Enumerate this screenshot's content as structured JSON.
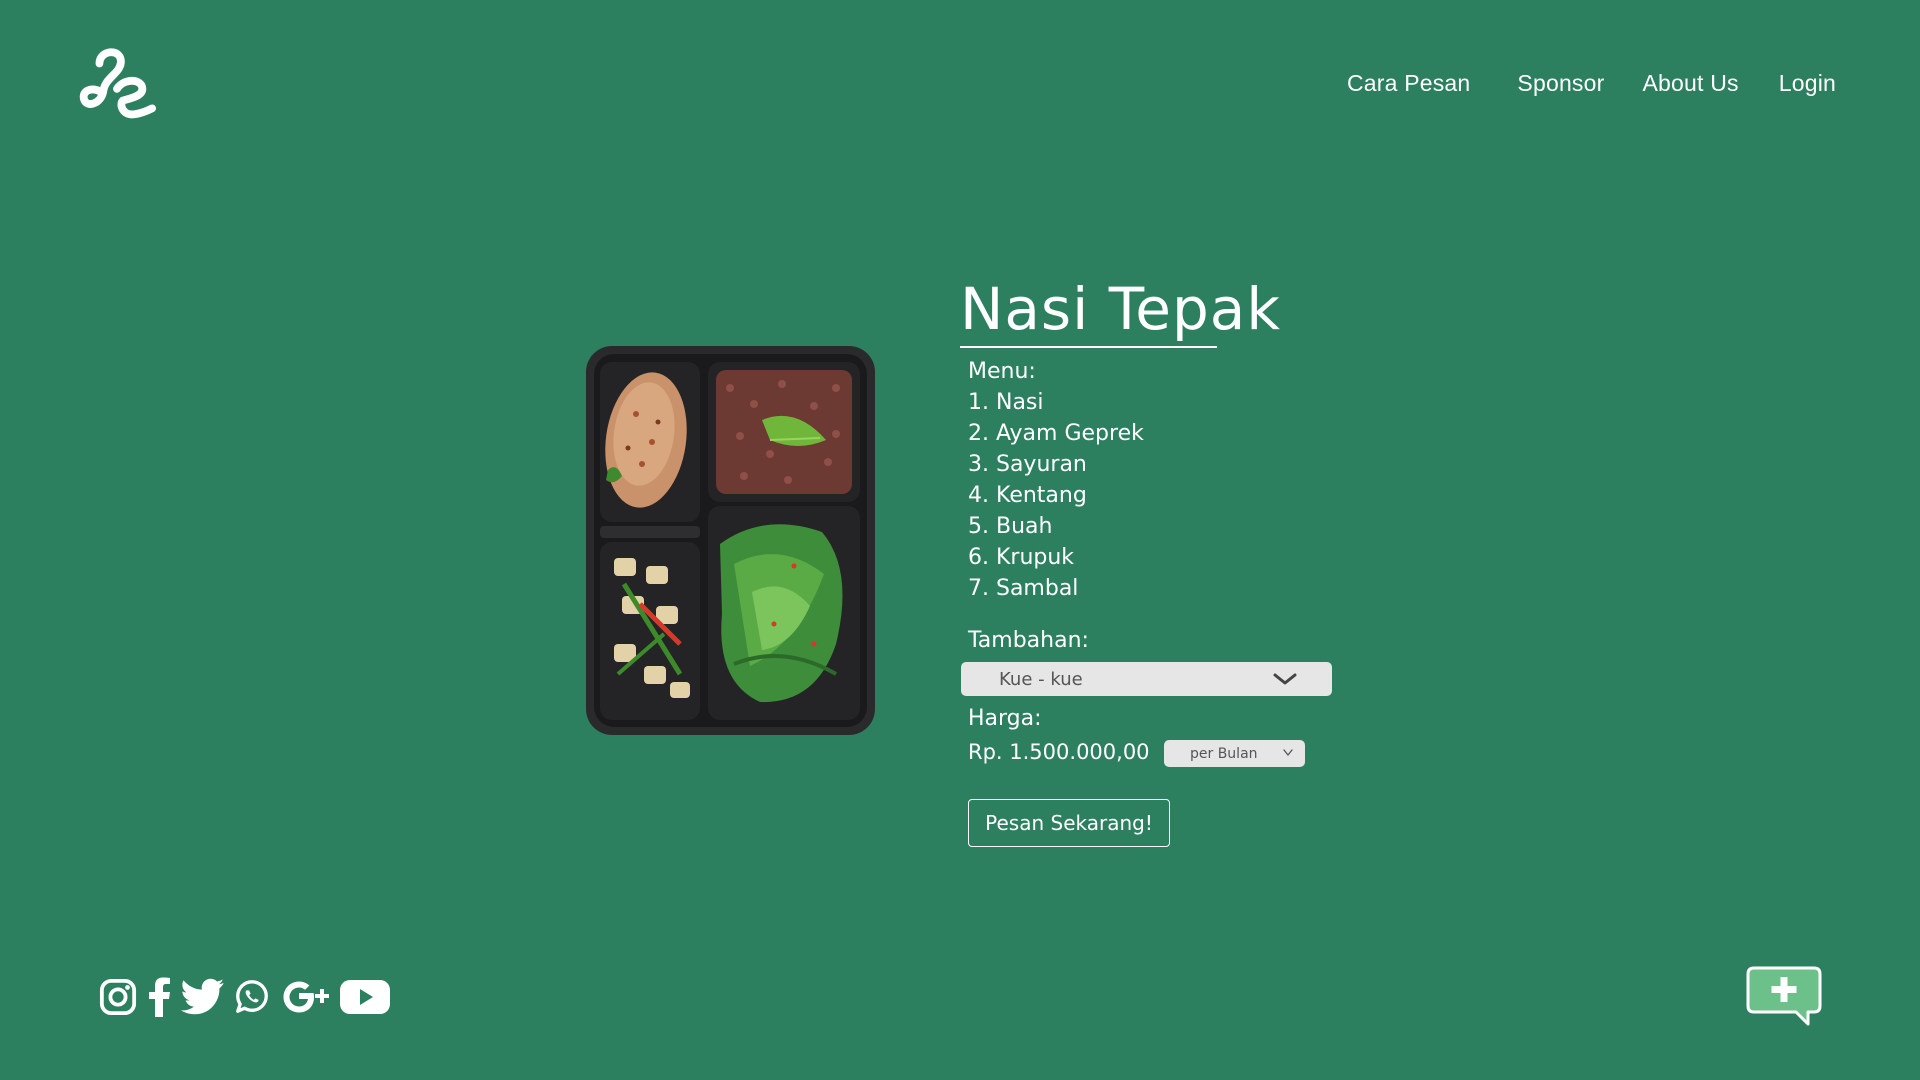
{
  "nav": {
    "items": [
      {
        "label": "Cara Pesan"
      },
      {
        "label": "Sponsor"
      },
      {
        "label": "About Us"
      },
      {
        "label": "Login"
      }
    ]
  },
  "product": {
    "title": "Nasi Tepak",
    "menu_label": "Menu:",
    "menu_items": [
      "1. Nasi",
      "2. Ayam Geprek",
      "3. Sayuran",
      "4. Kentang",
      "5. Buah",
      "6. Krupuk",
      "7. Sambal"
    ],
    "tambahan_label": "Tambahan:",
    "tambahan_selected": "Kue - kue",
    "harga_label": "Harga:",
    "price": "Rp. 1.500.000,00",
    "period_selected": "per Bulan",
    "order_button": "Pesan Sekarang!"
  },
  "social": {
    "icons": [
      "instagram-icon",
      "facebook-icon",
      "twitter-icon",
      "whatsapp-icon",
      "google-plus-icon",
      "youtube-icon"
    ]
  },
  "colors": {
    "background": "#2c805f",
    "text": "#ffffff",
    "select_bg": "#e6e6e6",
    "chat_accent": "#6cc08a"
  }
}
